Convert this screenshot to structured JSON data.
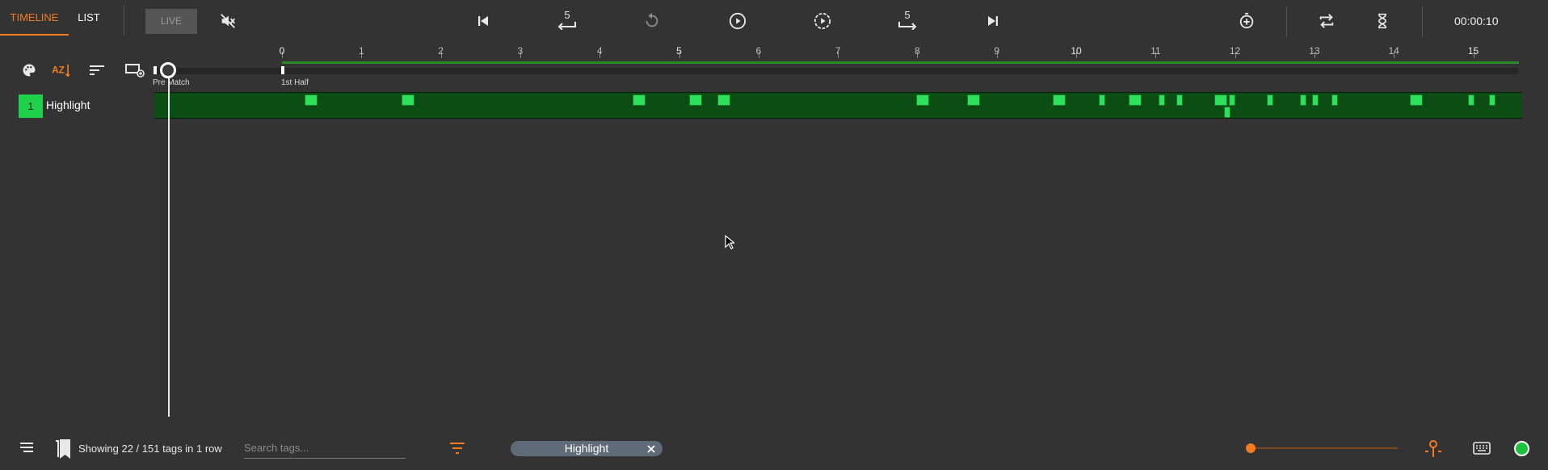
{
  "tabs": {
    "timeline": "TIMELINE",
    "list": "LIST"
  },
  "toolbar": {
    "live_label": "LIVE",
    "skip_back_label": "5",
    "skip_forward_label": "5",
    "clock": "00:00:10",
    "icons": [
      "mute-icon",
      "skip-start-icon",
      "rewind-5-icon",
      "replay-icon",
      "play-icon",
      "play-dashed-icon",
      "forward-5-icon",
      "skip-end-icon",
      "add-marker-icon",
      "loop-icon",
      "hourglass-icon"
    ]
  },
  "ruler": {
    "ticks": [
      "0",
      "1",
      "2",
      "3",
      "4",
      "5",
      "6",
      "7",
      "8",
      "9",
      "10",
      "11",
      "12",
      "13",
      "14",
      "15"
    ],
    "major": [
      "0",
      "5",
      "10",
      "15"
    ]
  },
  "phases": {
    "pre_match": "Pre Match",
    "first_half": "1st Half"
  },
  "rows": [
    {
      "index": "1",
      "name": "Highlight",
      "color": "#1fd14a",
      "clip_minutes": [
        0.28,
        1.51,
        4.41,
        5.13,
        5.48,
        7.99,
        8.63,
        9.71,
        10.28,
        10.66,
        11.04,
        11.26,
        11.74,
        11.92,
        11.86,
        12.4,
        12.82,
        12.97,
        13.21,
        14.2,
        14.93,
        15.2
      ]
    }
  ],
  "footer": {
    "status": "Showing 22 / 151 tags in 1 row",
    "search_placeholder": "Search tags...",
    "filter_chip": "Highlight",
    "zoom_level": 0.0,
    "connection_color": "#1fc23f"
  },
  "colors": {
    "accent": "#f47c20",
    "track": "#0b4d12",
    "clip": "#2ee05a"
  }
}
